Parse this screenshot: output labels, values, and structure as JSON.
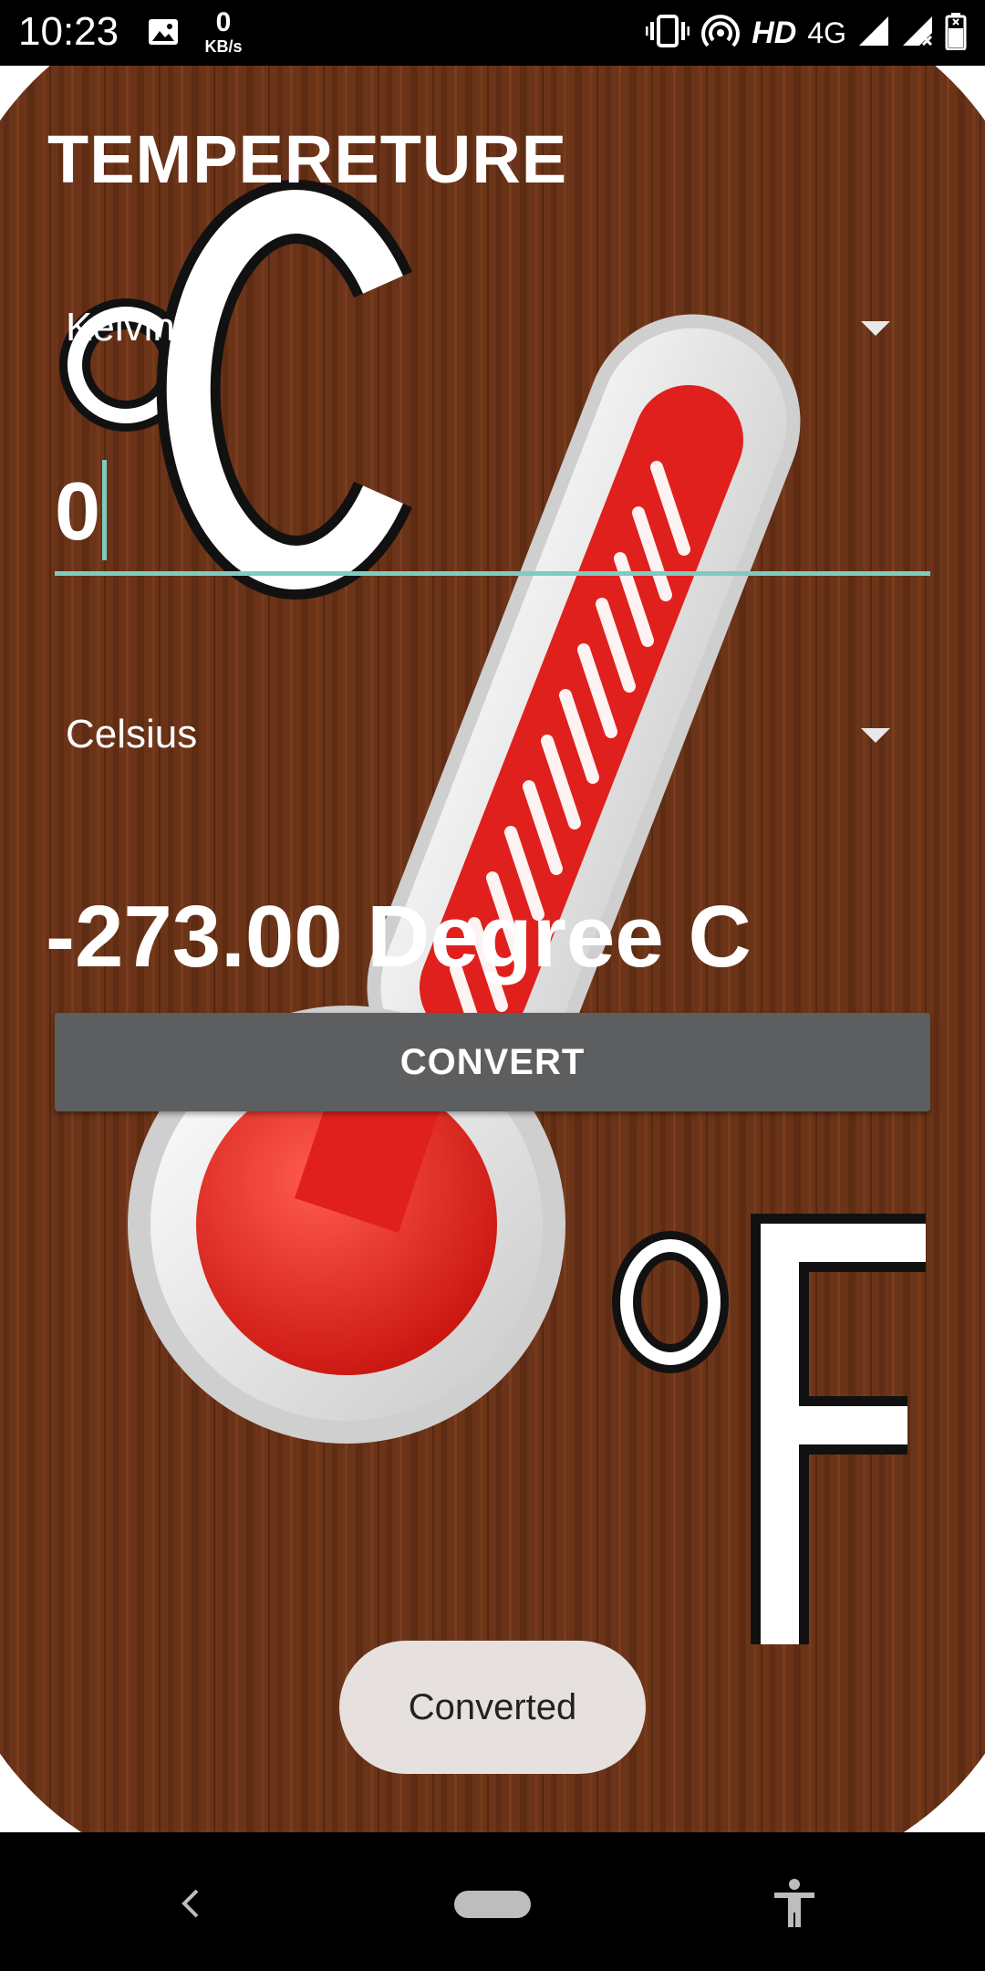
{
  "status_bar": {
    "time": "10:23",
    "net_speed_value": "0",
    "net_speed_unit": "KB/s",
    "hd_label": "HD",
    "network_label": "4G",
    "icons": [
      "gallery-icon",
      "vibrate-icon",
      "hotspot-icon",
      "signal-icon",
      "signal-no-data-icon",
      "battery-icon"
    ]
  },
  "app": {
    "title": "TEMPERETURE",
    "from_unit": "Kelvin",
    "input_value": "0",
    "to_unit": "Celsius",
    "result": "-273.00 Degree C",
    "convert_label": "CONVERT",
    "toast": "Converted"
  },
  "background_art": {
    "icons": [
      "celsius-symbol-icon",
      "thermometer-icon",
      "fahrenheit-symbol-icon"
    ],
    "wood_color": "#6b3318",
    "mercury_color": "#e0201d"
  },
  "nav_bar": {
    "icons": [
      "back-icon",
      "home-pill-icon",
      "accessibility-icon"
    ]
  },
  "colors": {
    "input_underline": "#7fcbc0",
    "button_bg": "#5d5e60",
    "toast_bg": "#e6e1df"
  }
}
